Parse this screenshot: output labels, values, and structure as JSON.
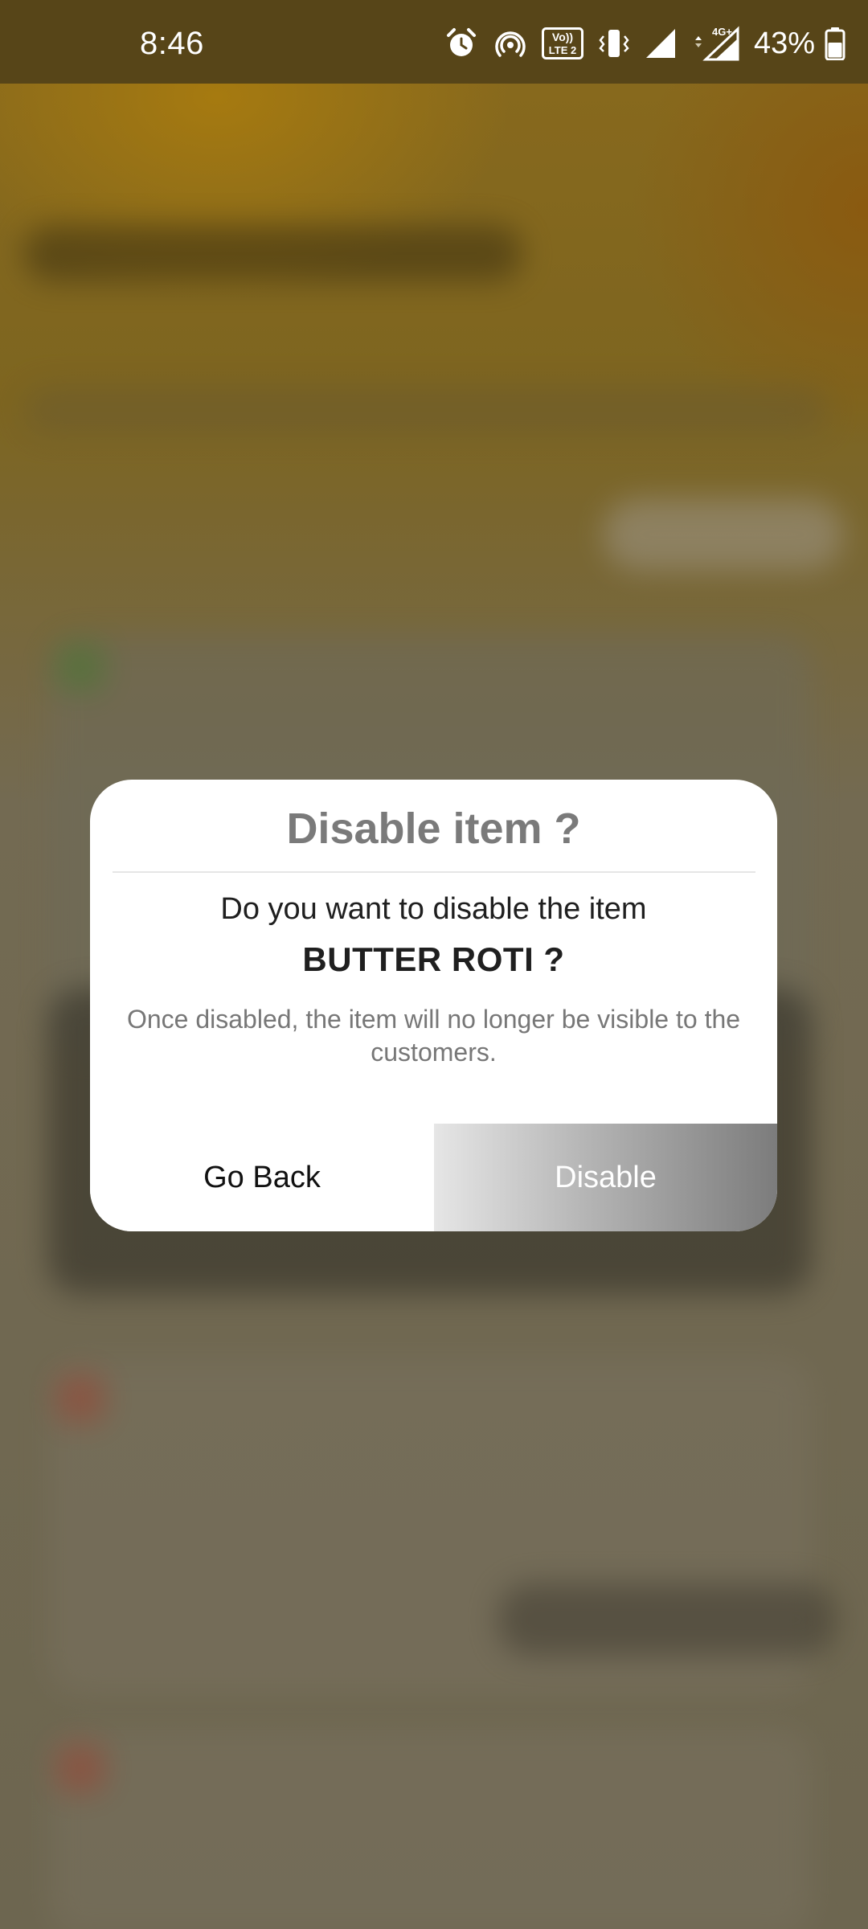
{
  "status_bar": {
    "time": "8:46",
    "battery_percent": "43%",
    "network_label": "4G+",
    "volte_label_top": "Vo))",
    "volte_label_bottom": "LTE 2",
    "icons": [
      "alarm-icon",
      "hotspot-icon",
      "volte-icon",
      "vibrate-icon",
      "signal-icon",
      "signal-4g-icon",
      "battery-icon"
    ]
  },
  "dialog": {
    "title": "Disable item ?",
    "question": "Do you want to disable the item",
    "item_name": "BUTTER ROTI ?",
    "note": "Once disabled, the item will no longer be visible to the customers.",
    "go_back_label": "Go Back",
    "disable_label": "Disable"
  },
  "colors": {
    "status_bar_bg": "#574518",
    "backdrop": "#6f6550",
    "dialog_bg": "#ffffff",
    "title_text": "#7a7a7a",
    "note_text": "#777777",
    "disable_gradient_end": "#7c7c7c"
  }
}
